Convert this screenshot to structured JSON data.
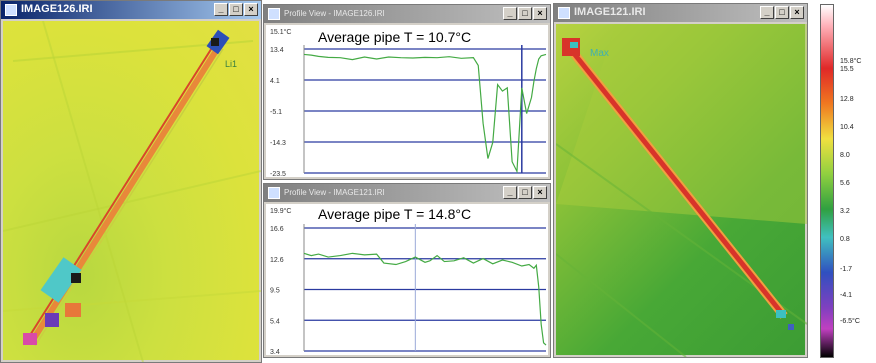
{
  "windows": {
    "left": {
      "title": "IMAGE126.IRI",
      "label": "Li1"
    },
    "right": {
      "title": "IMAGE121.IRI",
      "label": "Max"
    },
    "profile_top": {
      "title": "Profile View - IMAGE126.IRI",
      "annotation": "Average pipe T = 10.7°C"
    },
    "profile_bottom": {
      "title": "Profile View - IMAGE121.IRI",
      "annotation": "Average pipe T = 14.8°C"
    }
  },
  "window_buttons": {
    "minimize": "_",
    "maximize": "□",
    "close": "×"
  },
  "chart_data": [
    {
      "type": "line",
      "title": "",
      "yticks": [
        "15.1°C",
        "13.4",
        "4.1",
        "-5.1",
        "-14.3",
        "-23.5"
      ],
      "ylim": [
        -23.5,
        15.1
      ],
      "series": [
        {
          "color": "#44aa44",
          "x": [
            0,
            3,
            6,
            10,
            15,
            20,
            25,
            30,
            35,
            40,
            45,
            50,
            55,
            60,
            65,
            70,
            72,
            74,
            76,
            78,
            80,
            82,
            84,
            86,
            88,
            90,
            92,
            94,
            95,
            96,
            97,
            98,
            100
          ],
          "y": [
            13.4,
            13.2,
            12.8,
            12.5,
            12.4,
            11.8,
            12.6,
            12.0,
            12.6,
            12.4,
            12.3,
            12.5,
            12.4,
            12.7,
            12.2,
            12.4,
            10.0,
            -8,
            -19,
            -14,
            4,
            2,
            3,
            -20,
            -23,
            3,
            -5,
            0,
            5,
            9,
            12,
            13,
            13.4
          ]
        }
      ],
      "cursor_x": 90
    },
    {
      "type": "line",
      "title": "",
      "yticks": [
        "19.9°C",
        "16.6",
        "12.6",
        "9.5",
        "5.4",
        "3.4"
      ],
      "ylim": [
        3.4,
        19.9
      ],
      "series": [
        {
          "color": "#44aa44",
          "x": [
            0,
            3,
            6,
            10,
            15,
            20,
            25,
            30,
            33,
            38,
            42,
            46,
            50,
            52,
            55,
            58,
            62,
            66,
            70,
            74,
            78,
            82,
            86,
            90,
            93,
            95,
            96,
            97,
            98,
            99,
            100
          ],
          "y": [
            16.5,
            16.2,
            16.4,
            16.0,
            16.2,
            16.5,
            16.3,
            16.4,
            15.2,
            15.0,
            15.4,
            16.0,
            15.3,
            15.5,
            16.2,
            15.4,
            15.5,
            15.9,
            15.2,
            15.8,
            15.1,
            15.6,
            15.3,
            14.8,
            15.0,
            14.5,
            14.9,
            12.0,
            7.0,
            4.5,
            4.2
          ]
        }
      ],
      "cursor_x": 46
    }
  ],
  "colorbar": {
    "labels": [
      "15.8°C",
      "15.5",
      "12.8",
      "10.4",
      "8.0",
      "5.6",
      "3.2",
      "0.8",
      "-1.7",
      "-4.1",
      "-6.5°C"
    ]
  }
}
